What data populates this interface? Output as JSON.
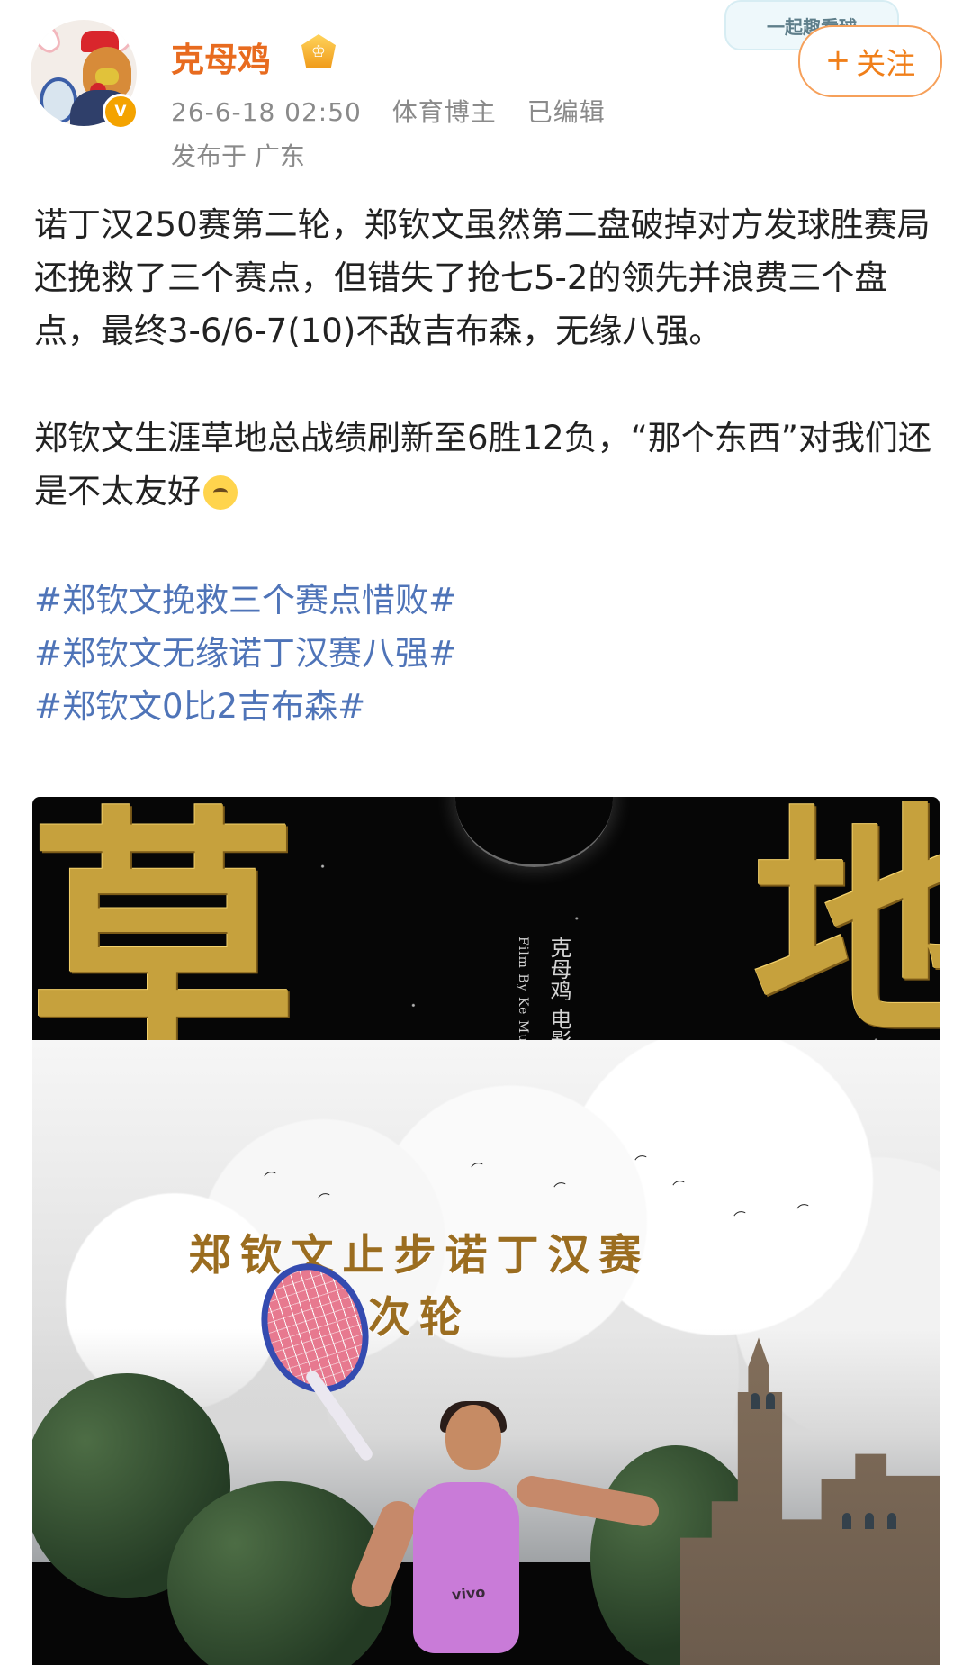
{
  "post": {
    "author": {
      "name": "克母鸡",
      "badge_icon": "crown-icon"
    },
    "meta": {
      "date": "26-6-18 02:50",
      "category": "体育博主",
      "edited": "已编辑"
    },
    "location": "发布于 广东",
    "follow": {
      "badge_text": "一起趣看球",
      "button_label": "关注",
      "button_icon": "+"
    },
    "paragraphs": [
      "诺丁汉250赛第二轮，郑钦文虽然第二盘破掉对方发球胜赛局还挽救了三个赛点，但错失了抢七5-2的领先并浪费三个盘点，最终3-6/6-7(10)不敌吉布森，无缘八强。",
      "郑钦文生涯草地总战绩刷新至6胜12负，“那个东西”对我们还是不太友好"
    ],
    "emoji": "crying-face-emoji",
    "hashtags": [
      "#郑钦文挽救三个赛点惜败#",
      "#郑钦文无缘诺丁汉赛八强#",
      "#郑钦文0比2吉布森#"
    ],
    "poster": {
      "gold_left": "草",
      "gold_right": "地",
      "credit_cn": "克母鸡 电影",
      "credit_en": "A Film By Ke Mu Ji",
      "title": "郑钦文止步诺丁汉赛次轮",
      "logo": "vivo"
    }
  },
  "colors": {
    "username": "#e86b1f",
    "hashtag": "#4f74b8",
    "follow": "#f07f1a"
  }
}
